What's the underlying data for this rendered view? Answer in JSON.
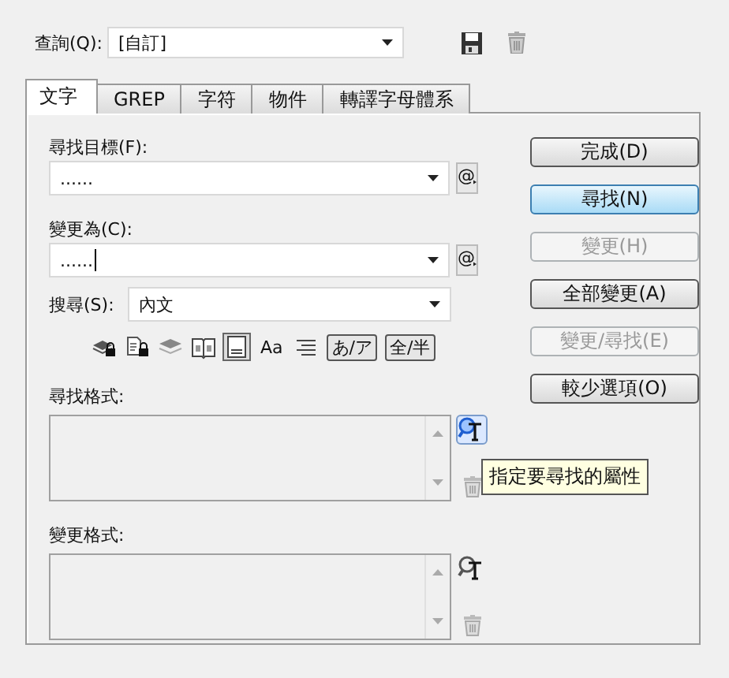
{
  "query": {
    "label": "查詢(Q):",
    "value": "[自訂]"
  },
  "tabs": [
    {
      "label": "文字",
      "selected": true
    },
    {
      "label": "GREP",
      "selected": false
    },
    {
      "label": "字符",
      "selected": false
    },
    {
      "label": "物件",
      "selected": false
    },
    {
      "label": "轉譯字母體系",
      "selected": false
    }
  ],
  "find_what": {
    "label": "尋找目標(F):",
    "value": "......",
    "button": "@"
  },
  "change_to": {
    "label": "變更為(C):",
    "value": "......",
    "button": "@"
  },
  "search": {
    "label": "搜尋(S):",
    "value": "內文"
  },
  "options": [
    {
      "kind": "locked-layers",
      "selected": false
    },
    {
      "kind": "locked-stories",
      "selected": false
    },
    {
      "kind": "hidden-layers",
      "selected": false
    },
    {
      "kind": "master-pages",
      "selected": false
    },
    {
      "kind": "footnotes",
      "selected": true
    },
    {
      "kind": "text",
      "text": "Aa",
      "selected": false
    },
    {
      "kind": "whole-word",
      "selected": false
    },
    {
      "kind": "text",
      "text": "あ/ア",
      "selected": true
    },
    {
      "kind": "text",
      "text": "全/半",
      "selected": true
    }
  ],
  "find_format": {
    "label": "尋找格式:",
    "active": true
  },
  "change_format": {
    "label": "變更格式:",
    "active": false
  },
  "tooltip": "指定要尋找的屬性",
  "buttons": [
    {
      "label": "完成(D)",
      "disabled": false,
      "default": false
    },
    {
      "label": "尋找(N)",
      "disabled": false,
      "default": true
    },
    {
      "label": "變更(H)",
      "disabled": true,
      "default": false
    },
    {
      "label": "全部變更(A)",
      "disabled": false,
      "default": false
    },
    {
      "label": "變更/尋找(E)",
      "disabled": true,
      "default": false
    },
    {
      "label": "較少選項(O)",
      "disabled": false,
      "default": false
    }
  ]
}
